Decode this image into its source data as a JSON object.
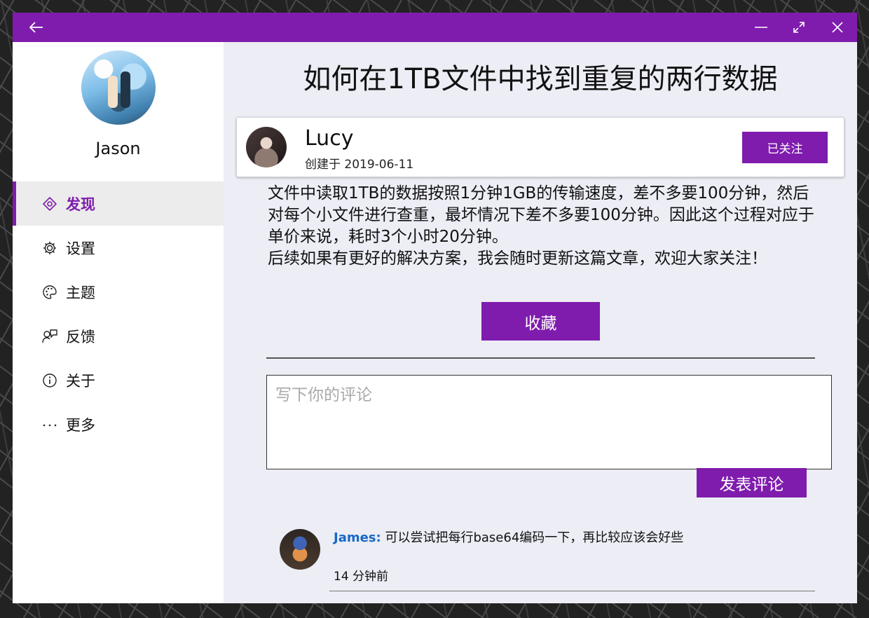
{
  "window": {
    "controls": {
      "back": "back-arrow-icon",
      "minimize": "minimize-icon",
      "maximize": "maximize-icon",
      "close": "close-icon"
    }
  },
  "sidebar": {
    "user_name": "Jason",
    "items": [
      {
        "label": "发现",
        "icon": "discover-icon",
        "active": true
      },
      {
        "label": "设置",
        "icon": "gear-icon"
      },
      {
        "label": "主题",
        "icon": "palette-icon"
      },
      {
        "label": "反馈",
        "icon": "feedback-icon"
      },
      {
        "label": "关于",
        "icon": "info-icon"
      },
      {
        "label": "更多",
        "icon": "more-icon"
      }
    ]
  },
  "article": {
    "title": "如何在1TB文件中找到重复的两行数据",
    "author": {
      "name": "Lucy",
      "created": "创建于 2019-06-11",
      "follow_label": "已关注"
    },
    "paragraphs": [
      "文件中读取1TB的数据按照1分钟1GB的传输速度，差不多要100分钟，然后对每个小文件进行查重，最坏情况下差不多要100分钟。因此这个过程对应于单价来说，耗时3个小时20分钟。",
      "后续如果有更好的解决方案，我会随时更新这篇文章，欢迎大家关注！"
    ],
    "favorite_label": "收藏"
  },
  "comment_form": {
    "placeholder": "写下你的评论",
    "value": "",
    "submit_label": "发表评论"
  },
  "comments": [
    {
      "author": "James:",
      "text": "可以尝试把每行base64编码一下，再比较应该会好些",
      "time": "14 分钟前"
    }
  ],
  "colors": {
    "accent": "#7f1cad",
    "comment_author": "#1768c7",
    "content_bg": "#ecedf5"
  }
}
